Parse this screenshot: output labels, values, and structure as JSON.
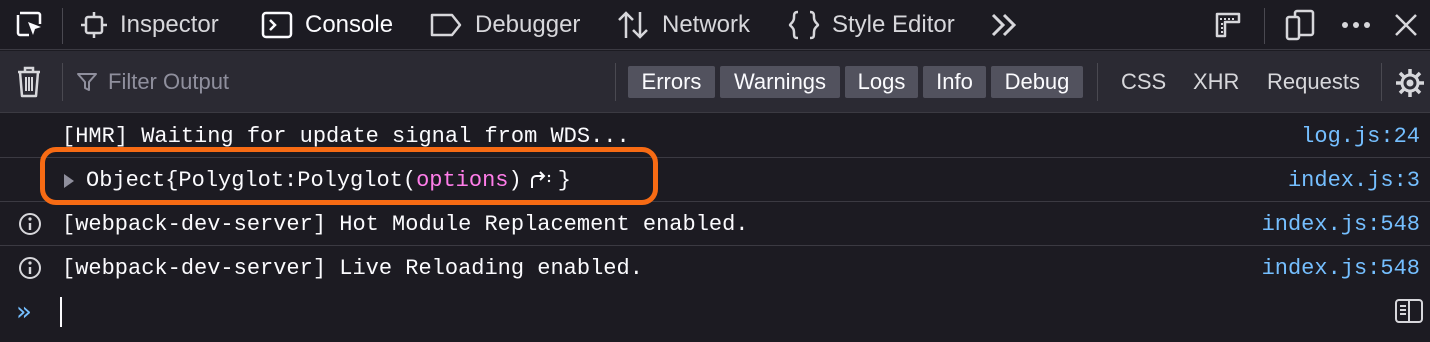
{
  "toolbar": {
    "tabs": [
      {
        "label": "Inspector",
        "icon": "inspector-icon"
      },
      {
        "label": "Console",
        "icon": "console-icon",
        "active": true
      },
      {
        "label": "Debugger",
        "icon": "debugger-icon"
      },
      {
        "label": "Network",
        "icon": "network-icon"
      },
      {
        "label": "Style Editor",
        "icon": "style-editor-icon"
      }
    ],
    "overflow_icon": "chevron-double-right-icon",
    "right_icons": [
      "responsive-design-icon",
      "dock-icon",
      "more-options-icon",
      "close-icon"
    ]
  },
  "filterbar": {
    "placeholder": "Filter Output",
    "levels": [
      "Errors",
      "Warnings",
      "Logs",
      "Info",
      "Debug"
    ],
    "types": [
      "CSS",
      "XHR",
      "Requests"
    ]
  },
  "messages": [
    {
      "text": "[HMR] Waiting for update signal from WDS...",
      "location": "log.js:24"
    },
    {
      "object_label": "Object",
      "open_brace": "{",
      "key": "Polyglot:",
      "value": "Polyglot(",
      "param": "options",
      "close_paren": ")",
      "close_brace": "}",
      "location": "index.js:3"
    },
    {
      "text": "[webpack-dev-server] Hot Module Replacement enabled.",
      "location": "index.js:548",
      "icon": "info-icon"
    },
    {
      "text": "[webpack-dev-server] Live Reloading enabled.",
      "location": "index.js:548",
      "icon": "info-icon"
    }
  ],
  "input": {
    "prompt": "»"
  },
  "colors": {
    "accent": "#75bfff",
    "highlight": "#f76b14",
    "param": "#ff7de9",
    "background": "#1c1b22"
  }
}
